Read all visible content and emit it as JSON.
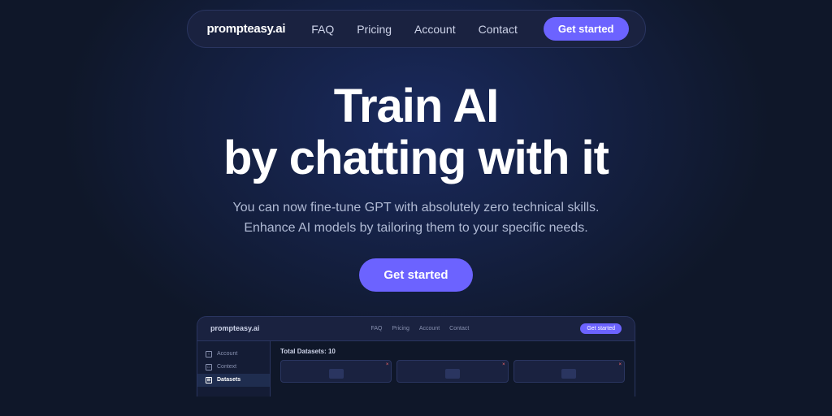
{
  "brand": {
    "logo": "prompteasy.ai"
  },
  "navbar": {
    "links": [
      {
        "label": "FAQ",
        "id": "faq"
      },
      {
        "label": "Pricing",
        "id": "pricing"
      },
      {
        "label": "Account",
        "id": "account"
      },
      {
        "label": "Contact",
        "id": "contact"
      }
    ],
    "cta": "Get started"
  },
  "hero": {
    "title_line1": "Train AI",
    "title_line2": "by chatting with it",
    "subtitle_line1": "You can now fine-tune GPT with absolutely zero technical skills.",
    "subtitle_line2": "Enhance AI models by tailoring them to your specific needs.",
    "cta": "Get started"
  },
  "preview": {
    "logo": "prompteasy.ai",
    "links": [
      "FAQ",
      "Pricing",
      "Account",
      "Contact"
    ],
    "cta": "Get started",
    "sidebar": [
      {
        "label": "Account",
        "icon": "person"
      },
      {
        "label": "Context",
        "icon": "file"
      },
      {
        "label": "Datasets",
        "icon": "grid",
        "active": true
      }
    ],
    "content_header": "Total Datasets: 10",
    "cards": [
      {
        "close": "×"
      },
      {
        "close": "×"
      },
      {
        "close": "×"
      }
    ]
  },
  "colors": {
    "accent": "#6c63ff",
    "bg_dark": "#0f1729",
    "bg_card": "#1a2240",
    "text_muted": "#b0bad4"
  }
}
